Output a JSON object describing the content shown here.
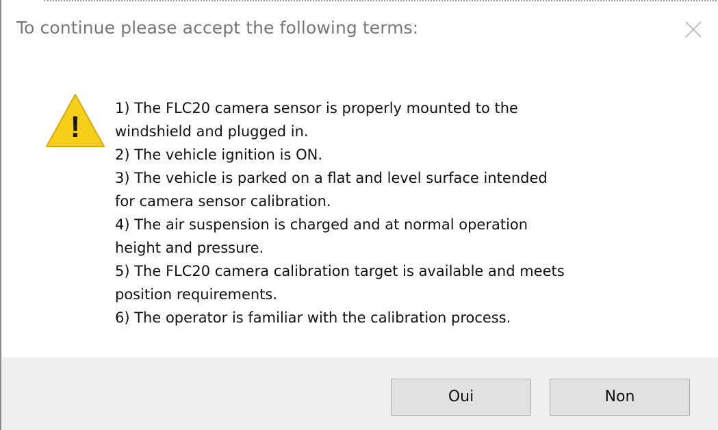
{
  "dialog": {
    "title": "To continue please accept the following terms:",
    "icons": {
      "close": "close-icon",
      "warning": "warning-icon"
    },
    "warning_glyph": "!",
    "terms": [
      "1) The FLC20 camera sensor is properly mounted to the",
      "windshield and plugged in.",
      "2) The vehicle ignition is ON.",
      "3) The vehicle is parked on a flat and level surface intended",
      "for camera sensor calibration.",
      "4) The air suspension is charged and at normal operation",
      "height and pressure.",
      "5) The FLC20 camera calibration target is available and meets",
      "position requirements.",
      "6) The operator is familiar with the calibration process."
    ],
    "buttons": {
      "yes_label": "Oui",
      "no_label": "Non"
    },
    "colors": {
      "warning_fill": "#F7CF1B",
      "footer_background": "#F0F0F0",
      "title_text": "#767676"
    }
  }
}
